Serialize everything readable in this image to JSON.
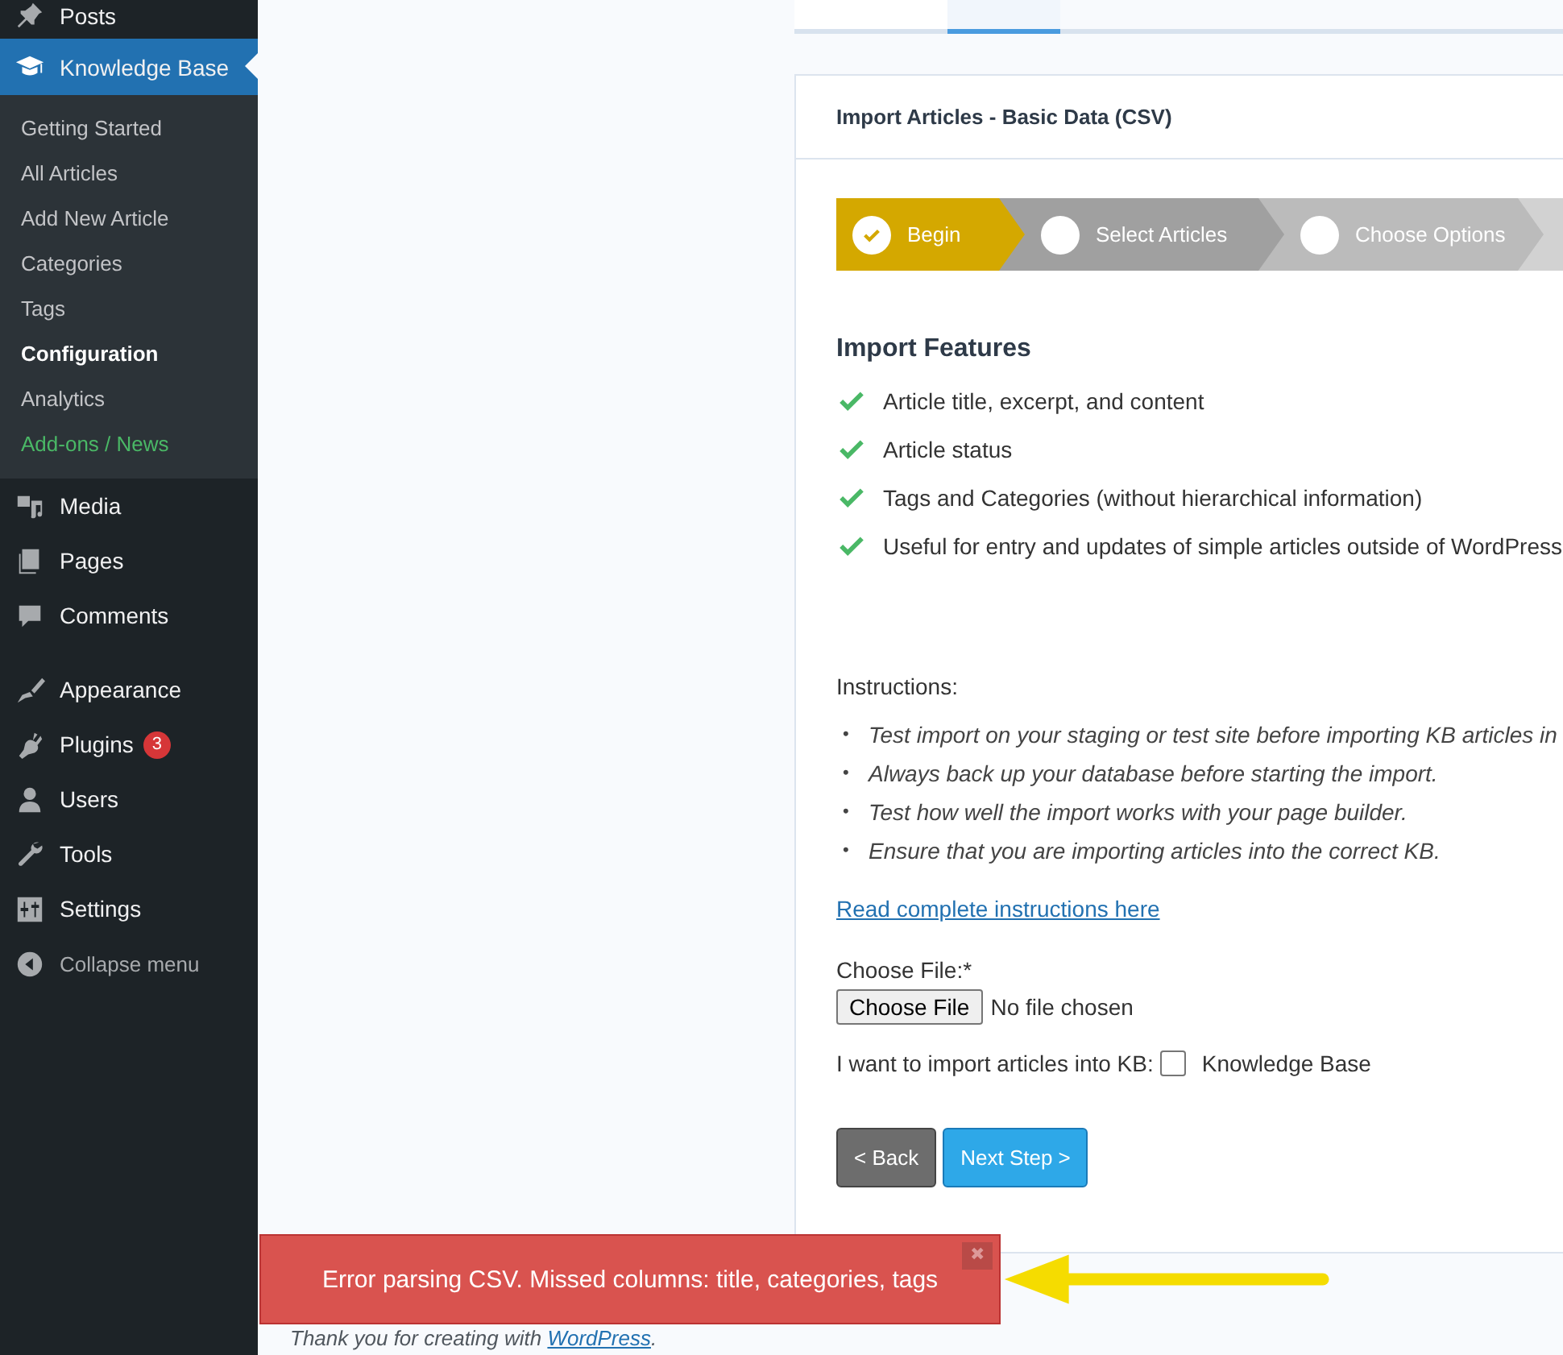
{
  "sidebar": {
    "items": [
      {
        "label": "Posts",
        "selected": false
      },
      {
        "label": "Knowledge Base",
        "selected": true,
        "children": [
          {
            "label": "Getting Started",
            "selected": false,
            "kind": "normal"
          },
          {
            "label": "All Articles",
            "selected": false,
            "kind": "normal"
          },
          {
            "label": "Add New Article",
            "selected": false,
            "kind": "normal"
          },
          {
            "label": "Categories",
            "selected": false,
            "kind": "normal"
          },
          {
            "label": "Tags",
            "selected": false,
            "kind": "normal"
          },
          {
            "label": "Configuration",
            "selected": true,
            "kind": "normal"
          },
          {
            "label": "Analytics",
            "selected": false,
            "kind": "normal"
          },
          {
            "label": "Add-ons / News",
            "selected": false,
            "kind": "highlight"
          }
        ]
      },
      {
        "label": "Media",
        "selected": false
      },
      {
        "label": "Pages",
        "selected": false
      },
      {
        "label": "Comments",
        "selected": false
      },
      {
        "label": "Appearance",
        "selected": false
      },
      {
        "label": "Plugins",
        "selected": false,
        "badge": "3"
      },
      {
        "label": "Users",
        "selected": false
      },
      {
        "label": "Tools",
        "selected": false
      },
      {
        "label": "Settings",
        "selected": false
      }
    ],
    "collapse": "Collapse menu"
  },
  "tabs": [
    {
      "selected": false
    },
    {
      "selected": true
    }
  ],
  "panel": {
    "title": "Import Articles - Basic Data (CSV)",
    "steps": [
      {
        "label": "Begin",
        "done": true
      },
      {
        "label": "Select Articles",
        "done": false
      },
      {
        "label": "Choose Options",
        "done": false
      }
    ],
    "features_title": "Import Features",
    "features": [
      "Article title, excerpt, and content",
      "Article status",
      "Tags and Categories (without hierarchical information)",
      "Useful for entry and updates of simple articles outside of WordPress"
    ],
    "instructions_label": "Instructions:",
    "instructions": [
      {
        "marker": "•",
        "text": "Test import on your staging or test site before importing KB articles in"
      },
      {
        "marker": "•",
        "text": "Always back up your database before starting the import."
      },
      {
        "marker": "•",
        "text": "Test how well the import works with your page builder."
      },
      {
        "marker": "•",
        "text": "Ensure that you are importing articles into the correct KB."
      }
    ],
    "link": "Read complete instructions here",
    "file_label": "Choose File:*",
    "file_button": "Choose File",
    "file_status": "No file chosen",
    "kb_label": "I want to import articles into KB:",
    "kb_option": {
      "label": "Knowledge Base",
      "checked": false
    },
    "back": "< Back",
    "next": "Next Step >"
  },
  "footer": {
    "text": "Thank you for creating with ",
    "link": "WordPress",
    "end": "."
  },
  "toast": {
    "message": "Error parsing CSV. Missed columns: title, categories, tags",
    "close": "✖"
  }
}
